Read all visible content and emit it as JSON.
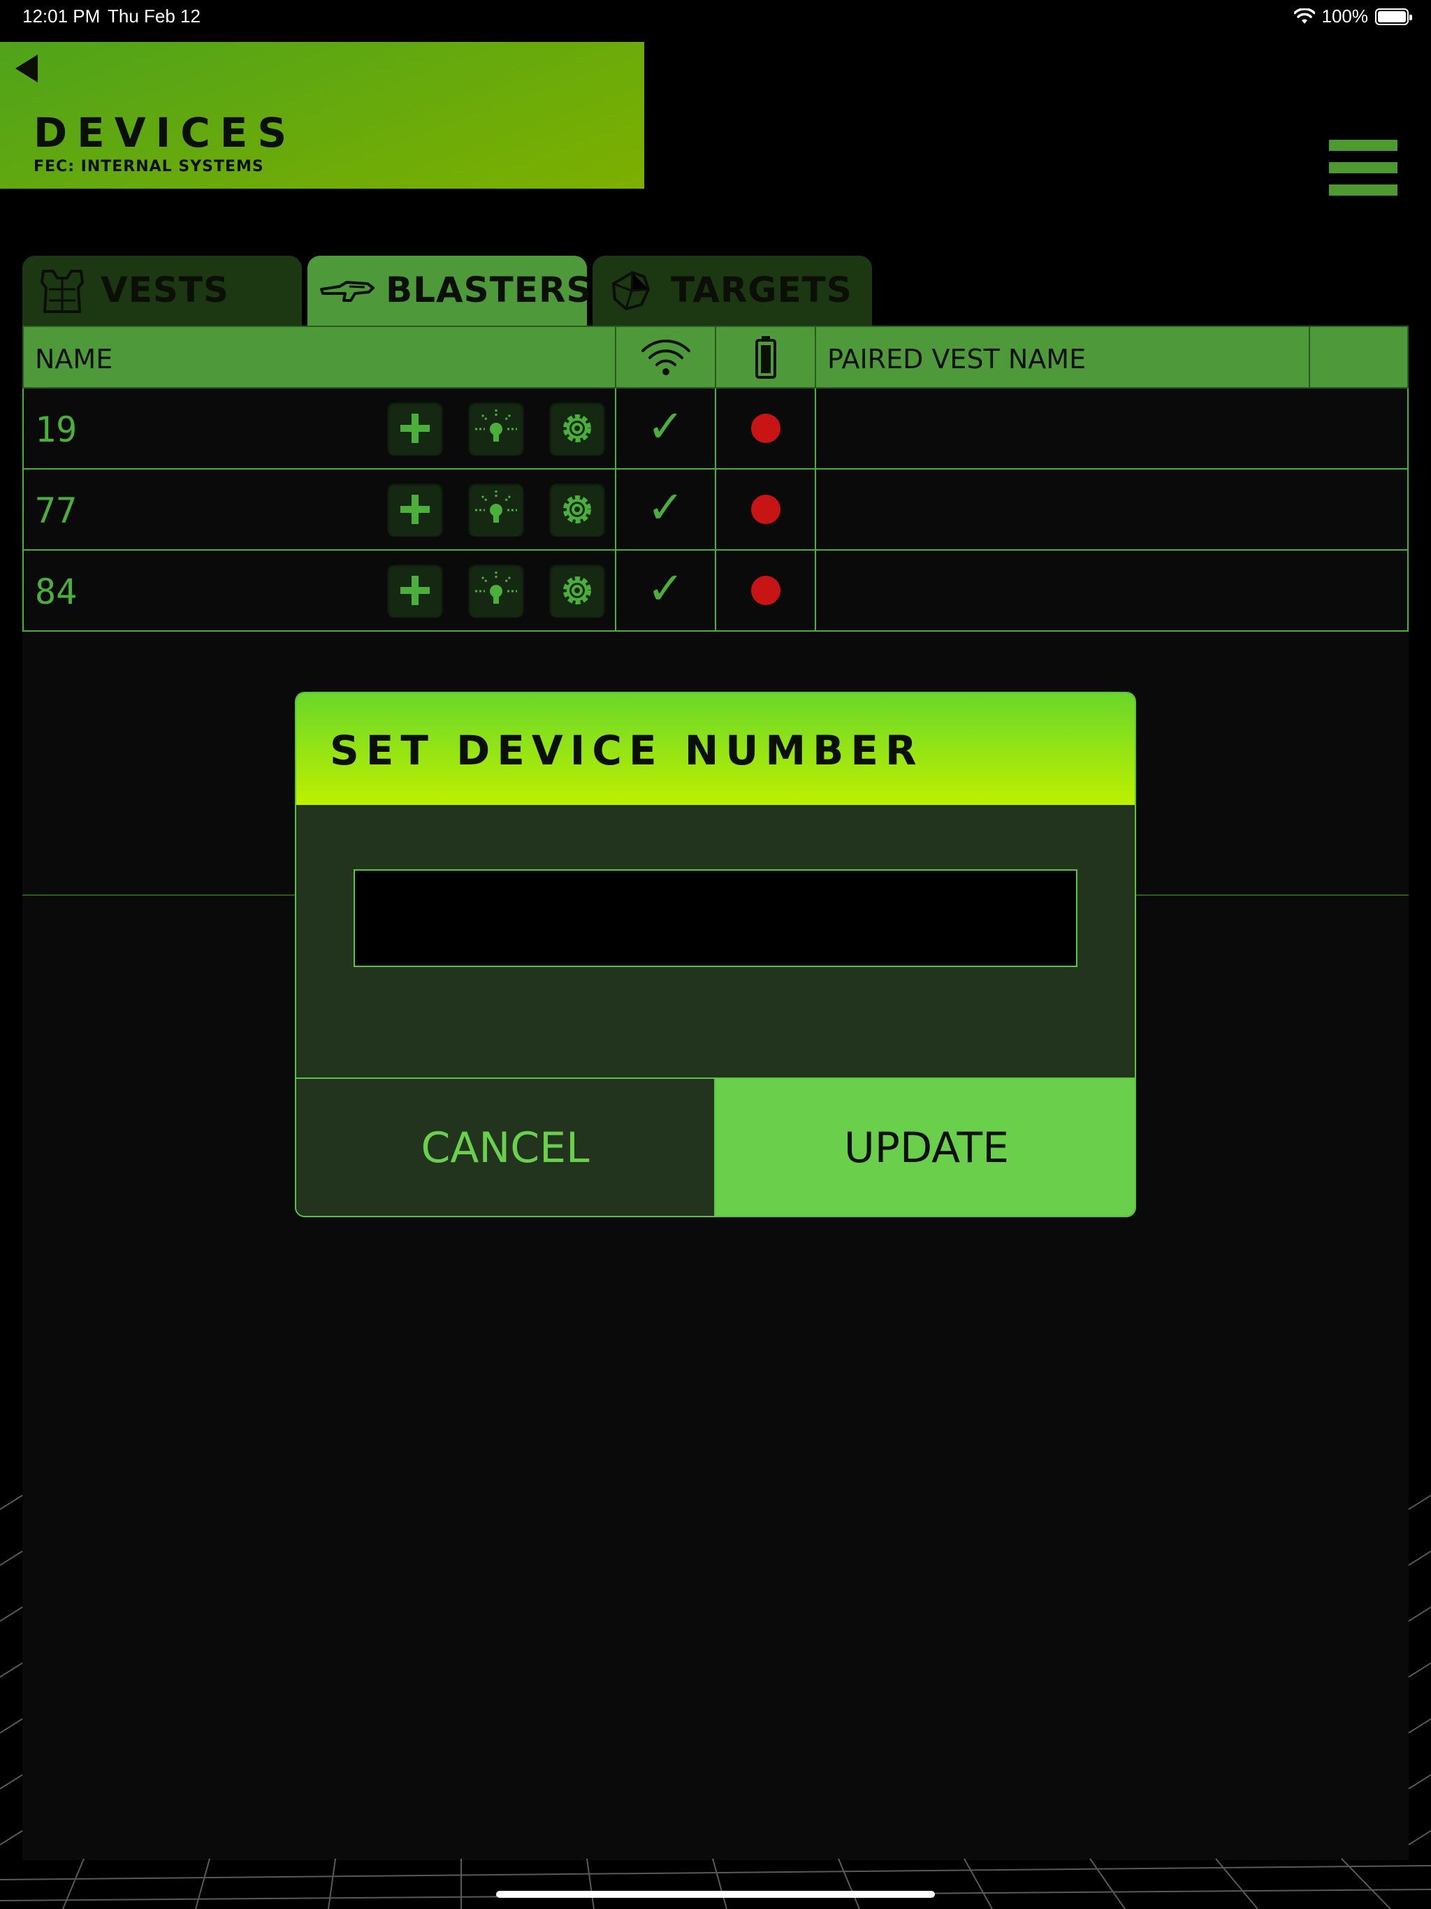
{
  "status_bar": {
    "time": "12:01 PM",
    "date": "Thu Feb 12",
    "battery": "100%"
  },
  "header": {
    "title": "DEVICES",
    "subtitle": "FEC: INTERNAL SYSTEMS"
  },
  "tabs": [
    {
      "label": "VESTS",
      "icon": "vest-icon",
      "active": false
    },
    {
      "label": "BLASTERS",
      "icon": "blaster-icon",
      "active": true
    },
    {
      "label": "TARGETS",
      "icon": "target-icon",
      "active": false
    }
  ],
  "table": {
    "columns": {
      "name": "NAME",
      "wifi_icon": "wifi-icon",
      "battery_icon": "battery-icon",
      "paired": "PAIRED VEST NAME"
    },
    "rows": [
      {
        "name": "19",
        "connected": "✓",
        "battery_status": "low",
        "paired_vest": ""
      },
      {
        "name": "77",
        "connected": "✓",
        "battery_status": "low",
        "paired_vest": ""
      },
      {
        "name": "84",
        "connected": "✓",
        "battery_status": "low",
        "paired_vest": ""
      }
    ]
  },
  "modal": {
    "title": "SET DEVICE NUMBER",
    "input_value": "",
    "input_placeholder": "",
    "cancel_label": "CANCEL",
    "update_label": "UPDATE"
  },
  "colors": {
    "accent": "#4e9a3a",
    "bright_green": "#6ad04c",
    "status_red": "#c81414"
  }
}
